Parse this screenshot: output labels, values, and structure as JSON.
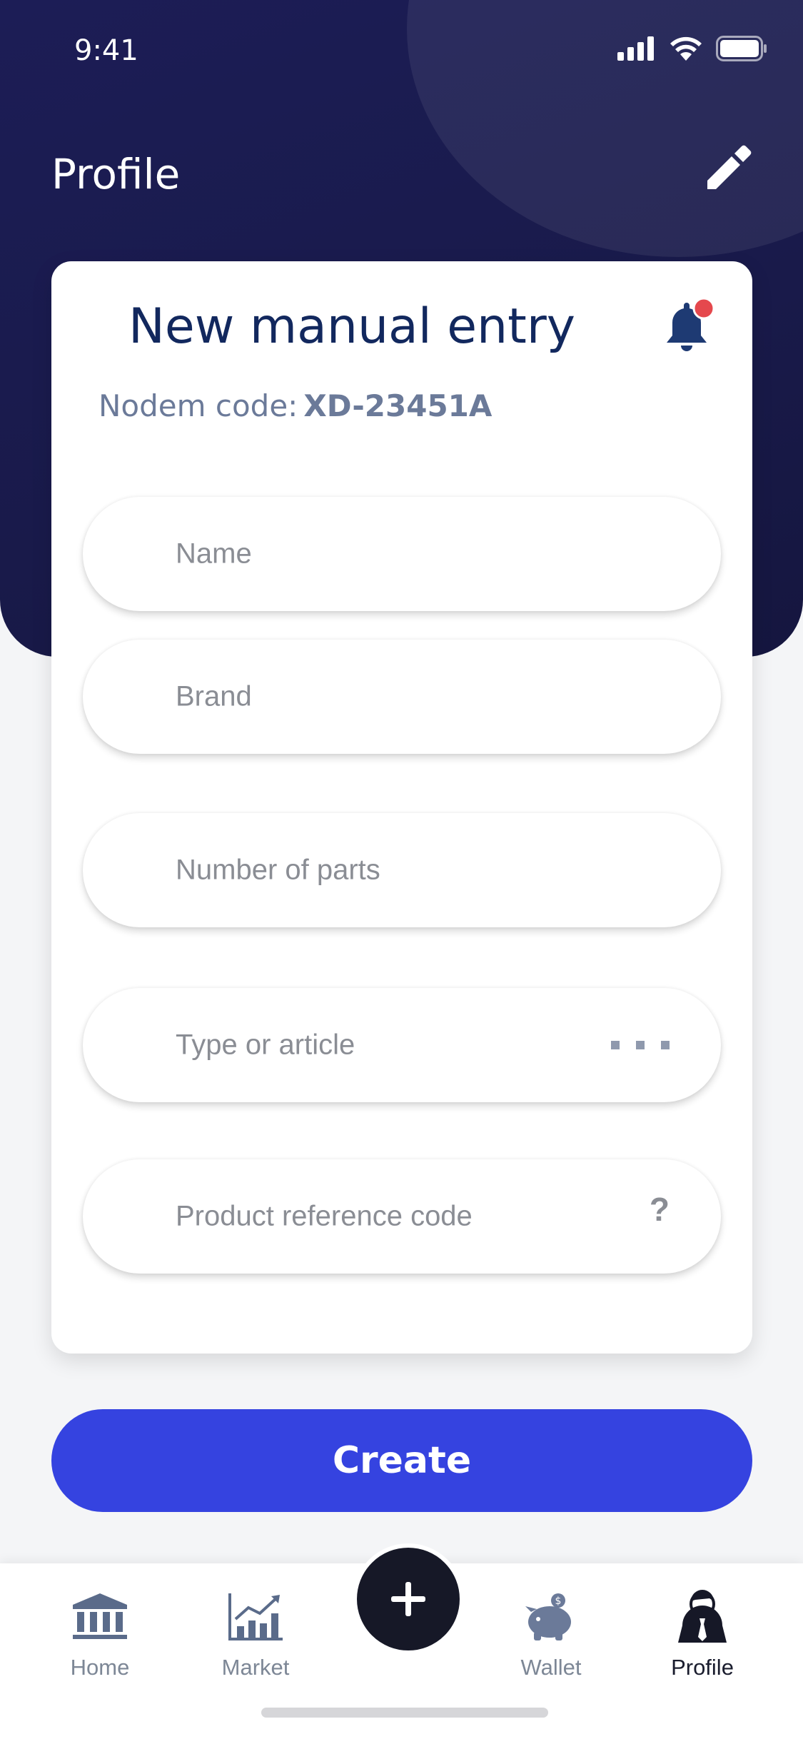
{
  "status": {
    "time": "9:41"
  },
  "header": {
    "title": "Profile"
  },
  "card": {
    "title": "New manual entry",
    "code_label": "Nodem code:",
    "code_value": "XD-23451A"
  },
  "form": {
    "name_placeholder": "Name",
    "brand_placeholder": "Brand",
    "parts_placeholder": "Number of parts",
    "type_placeholder": "Type or article",
    "ref_placeholder": "Product reference code",
    "help_glyph": "?"
  },
  "actions": {
    "create_label": "Create"
  },
  "tabbar": {
    "home": "Home",
    "market": "Market",
    "wallet": "Wallet",
    "profile": "Profile",
    "active": "Profile"
  },
  "colors": {
    "primary": "#3543e0",
    "header": "#1c1d56",
    "badge": "#e5484d"
  }
}
